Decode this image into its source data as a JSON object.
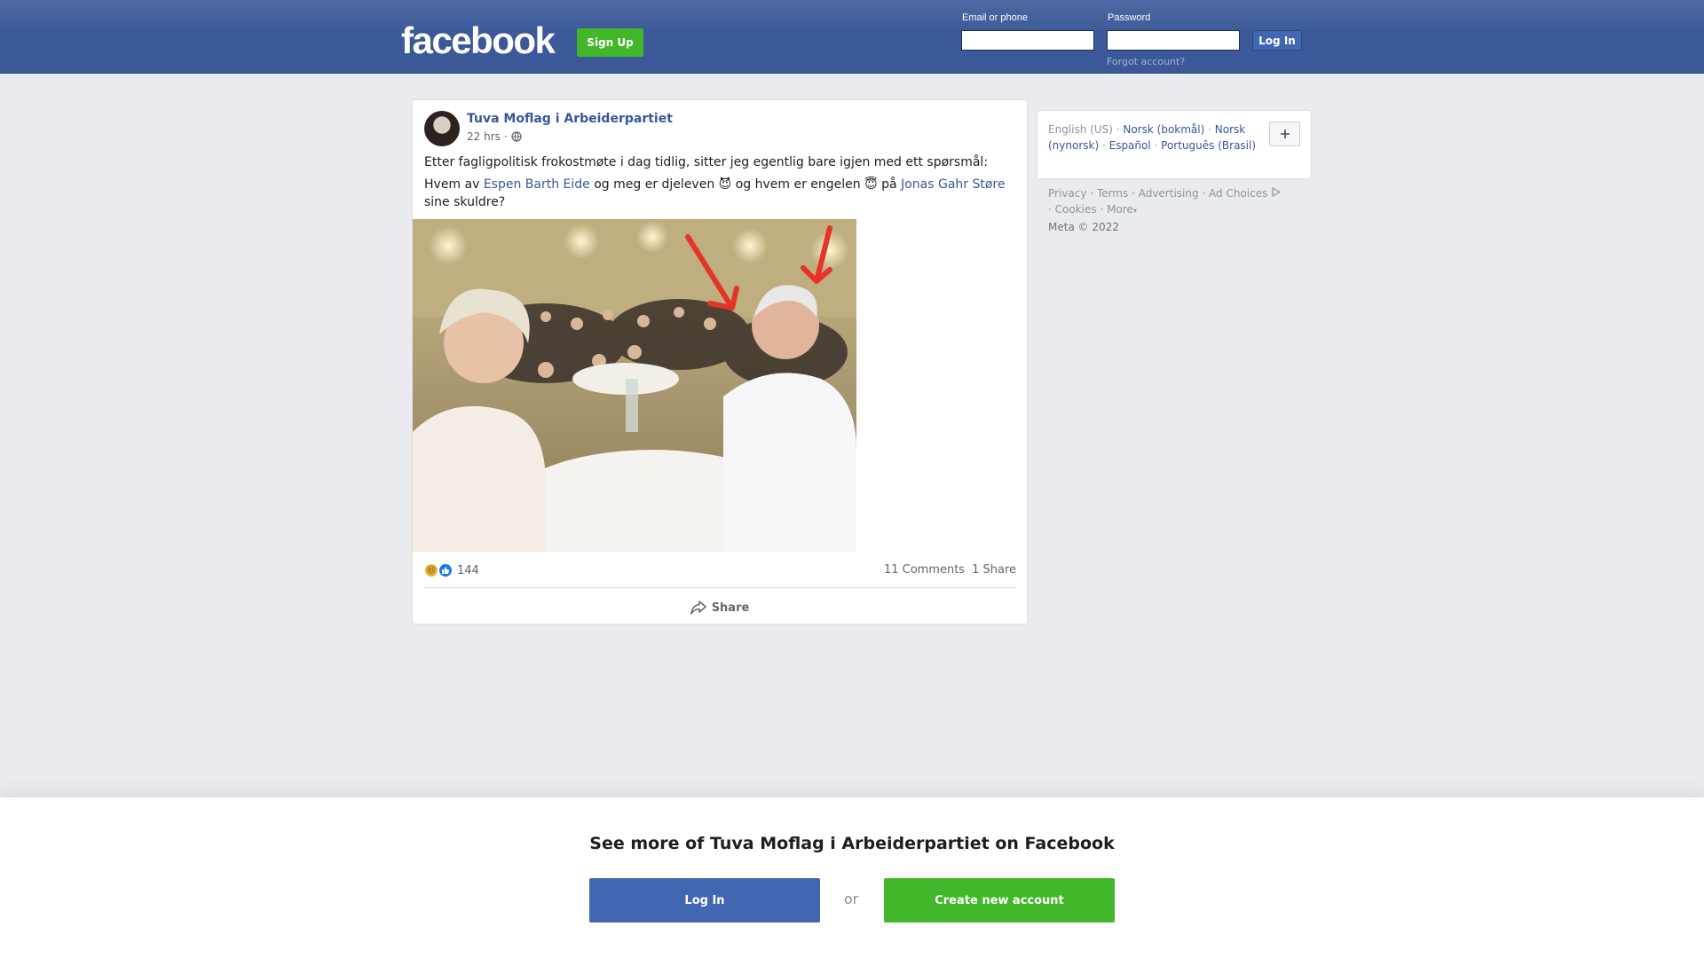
{
  "header": {
    "logo": "facebook",
    "signup_label": "Sign Up",
    "email_label": "Email or phone",
    "password_label": "Password",
    "login_label": "Log In",
    "forgot_label": "Forgot account?"
  },
  "post": {
    "author": "Tuva Moflag i Arbeiderpartiet",
    "time": "22 hrs",
    "time_sep": "·",
    "text_line1": "Etter fagligpolitisk frokostmøte i dag tidlig, sitter jeg egentlig bare igjen med ett spørsmål:",
    "text_a": "Hvem av ",
    "mention1": "Espen Barth Eide",
    "text_b": " og meg er djeleven ",
    "emoji_devil": "😈",
    "text_c": " og hvem er engelen ",
    "emoji_angel": "😇",
    "text_d": " på ",
    "mention2": "Jonas Gahr Støre",
    "text_e": " sine skuldre?",
    "reaction_count": "144",
    "comments": "11 Comments",
    "shares": "1 Share",
    "share_action": "Share"
  },
  "sidebar": {
    "current_language": "English (US)",
    "languages": [
      "Norsk (bokmål)",
      "Norsk (nynorsk)",
      "Español",
      "Português (Brasil)"
    ],
    "footer_links": [
      "Privacy",
      "Terms",
      "Advertising",
      "Ad Choices",
      "Cookies",
      "More"
    ],
    "copyright": "Meta © 2022"
  },
  "overlay": {
    "title": "See more of Tuva Moflag i Arbeiderpartiet on Facebook",
    "login_label": "Log In",
    "or_label": "or",
    "create_label": "Create new account"
  },
  "colors": {
    "brand_blue": "#3b5998",
    "button_blue": "#4267b2",
    "signup_green": "#42b72a",
    "link_blue": "#385898"
  }
}
